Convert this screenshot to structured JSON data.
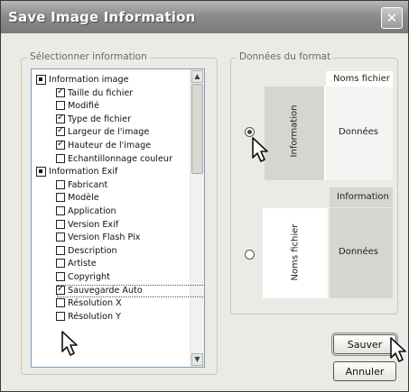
{
  "window": {
    "title": "Save Image Information",
    "close_glyph": "✕"
  },
  "select_group": {
    "label": "Sélectionner information",
    "items": [
      {
        "label": "Information image",
        "checked": true,
        "level": 0
      },
      {
        "label": "Taille du fichier",
        "checked": true,
        "level": 1
      },
      {
        "label": "Modifié",
        "checked": false,
        "level": 1
      },
      {
        "label": "Type de fichier",
        "checked": true,
        "level": 1
      },
      {
        "label": "Largeur de l'image",
        "checked": true,
        "level": 1
      },
      {
        "label": "Hauteur de l'image",
        "checked": true,
        "level": 1
      },
      {
        "label": "Echantillonnage couleur",
        "checked": false,
        "level": 1
      },
      {
        "label": "Information Exif",
        "checked": true,
        "level": 0
      },
      {
        "label": "Fabricant",
        "checked": false,
        "level": 1
      },
      {
        "label": "Modèle",
        "checked": false,
        "level": 1
      },
      {
        "label": "Application",
        "checked": false,
        "level": 1
      },
      {
        "label": "Version Exif",
        "checked": false,
        "level": 1
      },
      {
        "label": "Version Flash Pix",
        "checked": false,
        "level": 1
      },
      {
        "label": "Description",
        "checked": false,
        "level": 1
      },
      {
        "label": "Artiste",
        "checked": false,
        "level": 1
      },
      {
        "label": "Copyright",
        "checked": false,
        "level": 1
      },
      {
        "label": "Sauvegarde Auto",
        "checked": true,
        "level": 1
      },
      {
        "label": "Résolution X",
        "checked": false,
        "level": 1
      },
      {
        "label": "Résolution Y",
        "checked": false,
        "level": 1
      }
    ],
    "selected_item": "Sauvegarde Auto"
  },
  "format_group": {
    "label": "Données du format",
    "option1": {
      "header": "Noms fichier",
      "side": "Information",
      "body": "Données",
      "selected": true
    },
    "option2": {
      "header": "Information",
      "side": "Noms fichier",
      "body": "Données",
      "selected": false
    }
  },
  "buttons": {
    "save": "Sauver",
    "cancel": "Annuler"
  }
}
